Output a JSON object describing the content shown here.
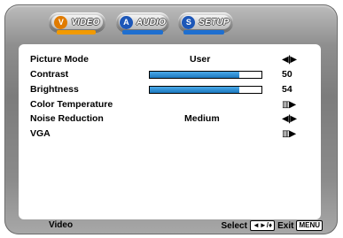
{
  "tabs": [
    {
      "label": "VIDEO",
      "badge": "V",
      "badge_color": "#e07b00",
      "underline": "#f29a00",
      "active": true
    },
    {
      "label": "AUDIO",
      "badge": "A",
      "badge_color": "#1d57b8",
      "underline": "#1e6fd0",
      "active": false
    },
    {
      "label": "SETUP",
      "badge": "S",
      "badge_color": "#1d57b8",
      "underline": "#1e6fd0",
      "active": false
    }
  ],
  "menu": {
    "picture_mode": {
      "label": "Picture Mode",
      "value": "User",
      "control": "◀|▶"
    },
    "contrast": {
      "label": "Contrast",
      "value": "50",
      "level_percent": 80
    },
    "brightness": {
      "label": "Brightness",
      "value": "54",
      "level_percent": 80
    },
    "color_temperature": {
      "label": "Color Temperature",
      "control": "▥▶"
    },
    "noise_reduction": {
      "label": "Noise Reduction",
      "value": "Medium",
      "control": "◀|▶"
    },
    "vga": {
      "label": "VGA",
      "control": "▥▶"
    }
  },
  "footer": {
    "section": "Video",
    "select_text": "Select",
    "select_key": "◄►/♦",
    "exit_text": "Exit",
    "exit_key": "MENU"
  },
  "colors": {
    "slider_fill": "#2b8fd6",
    "accent_orange": "#f29a00",
    "accent_blue": "#1e6fd0"
  }
}
